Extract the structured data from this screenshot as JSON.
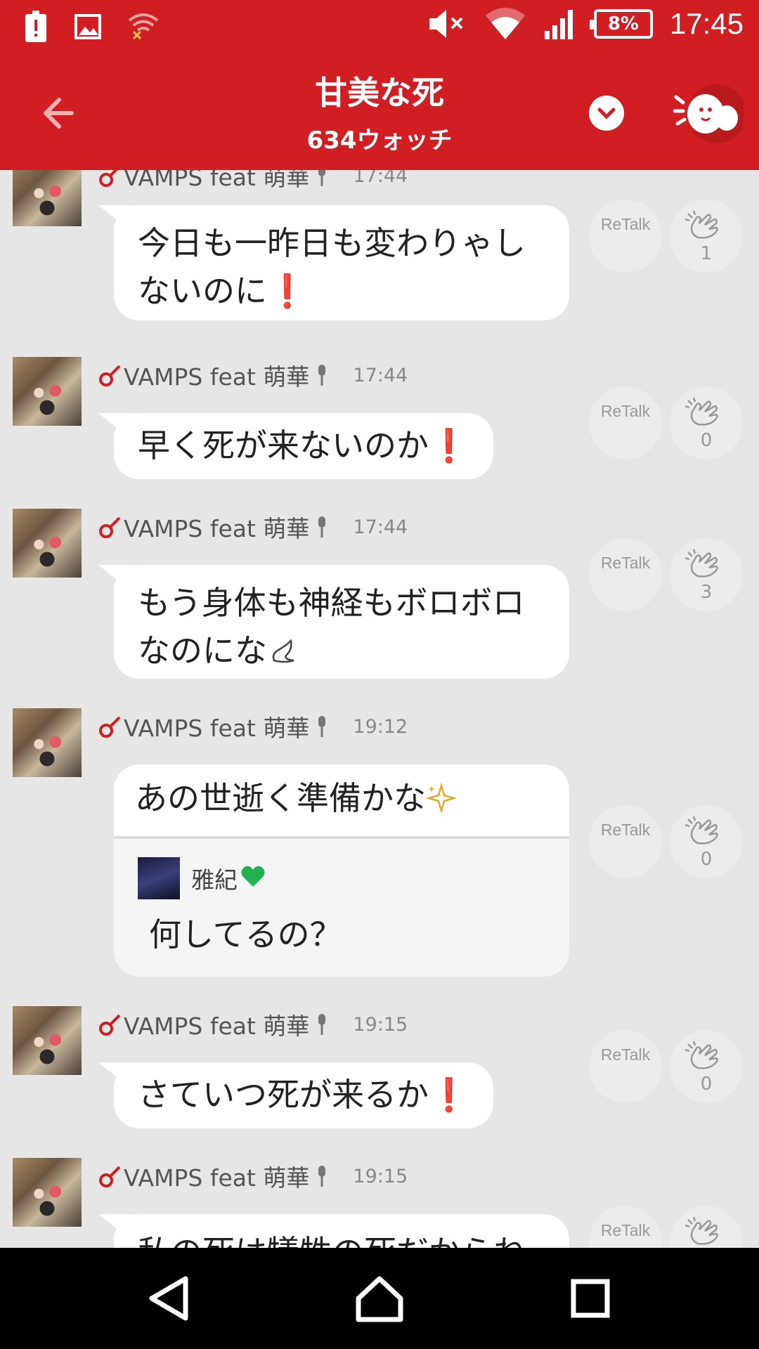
{
  "status_bar": {
    "time": "17:45",
    "battery": "8%",
    "left_icons": [
      "alert-icon",
      "image-icon",
      "wifi-off-icon"
    ],
    "right_icons": [
      "mute-icon",
      "wifi-icon",
      "signal-icon",
      "battery-icon"
    ]
  },
  "header": {
    "title": "甘美な死",
    "subtitle": "634ウォッチ"
  },
  "colors": {
    "brand": "#d01e22",
    "background": "#e6e6e6",
    "bubble": "#ffffff",
    "exclamation": "#e01b1b",
    "heart": "#22b14c"
  },
  "messages": [
    {
      "author": "VAMPS feat 萌華",
      "time": "17:44",
      "lines": [
        "今日も一昨日も変わりゃし",
        "ないのに"
      ],
      "suffix": "❗",
      "retalk": "ReTalk",
      "claps": "1"
    },
    {
      "author": "VAMPS feat 萌華",
      "time": "17:44",
      "lines": [
        "早く死が来ないのか"
      ],
      "suffix": "❗",
      "retalk": "ReTalk",
      "claps": "0"
    },
    {
      "author": "VAMPS feat 萌華",
      "time": "17:44",
      "lines": [
        "もう身体も神経もボロボロ",
        "なのにな"
      ],
      "suffix": "",
      "retalk": "ReTalk",
      "claps": "3"
    },
    {
      "author": "VAMPS feat 萌華",
      "time": "19:12",
      "lines": [
        "あの世逝く準備かな"
      ],
      "suffix": "",
      "quote": {
        "name": "雅紀",
        "text": "何してるの？"
      },
      "retalk": "ReTalk",
      "claps": "0"
    },
    {
      "author": "VAMPS feat 萌華",
      "time": "19:15",
      "lines": [
        "さていつ死が来るか"
      ],
      "suffix": "❗",
      "retalk": "ReTalk",
      "claps": "0"
    },
    {
      "author": "VAMPS feat 萌華",
      "time": "19:15",
      "lines": [
        "私の死は犠牲の死だからね"
      ],
      "suffix": "",
      "retalk": "ReTalk",
      "claps": ""
    }
  ]
}
